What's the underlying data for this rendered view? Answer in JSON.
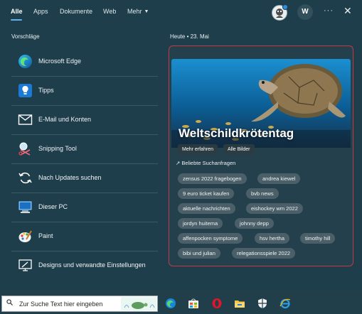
{
  "tabs": [
    "Alle",
    "Apps",
    "Dokumente",
    "Web",
    "Mehr"
  ],
  "account_initial": "W",
  "suggestions_title": "Vorschläge",
  "suggestions": [
    {
      "label": "Microsoft Edge",
      "icon": "edge-icon"
    },
    {
      "label": "Tipps",
      "icon": "tips-icon"
    },
    {
      "label": "E-Mail und Konten",
      "icon": "mail-icon"
    },
    {
      "label": "Snipping Tool",
      "icon": "snipping-tool-icon"
    },
    {
      "label": "Nach Updates suchen",
      "icon": "update-icon"
    },
    {
      "label": "Dieser PC",
      "icon": "computer-icon"
    },
    {
      "label": "Paint",
      "icon": "paint-icon"
    },
    {
      "label": "Designs und verwandte Einstellungen",
      "icon": "designs-icon"
    }
  ],
  "today": "Heute • 23. Mai",
  "hero": {
    "title": "Weltschildkrötentag",
    "btn_more": "Mehr erfahren",
    "btn_images": "Alle Bilder"
  },
  "popular_title": "Beliebte Suchanfragen",
  "chips": [
    "zensus 2022 fragebogen",
    "andrea kiewel",
    "9 euro ticket kaufen",
    "bvb news",
    "aktuelle nachrichten",
    "eishockey wm 2022",
    "jordyn huitema",
    "johnny depp",
    "affenpocken symptome",
    "hsv hertha",
    "timothy hill",
    "bibi und julian",
    "relegationsspiele 2022"
  ],
  "search_placeholder": "Zur Suche Text hier eingeben",
  "taskbar_icons": [
    "edge-icon",
    "store-icon",
    "opera-icon",
    "file-explorer-icon",
    "security-icon",
    "ie-icon"
  ],
  "accent_color": "#5fb2f2",
  "highlight_border_color": "#c23a47"
}
